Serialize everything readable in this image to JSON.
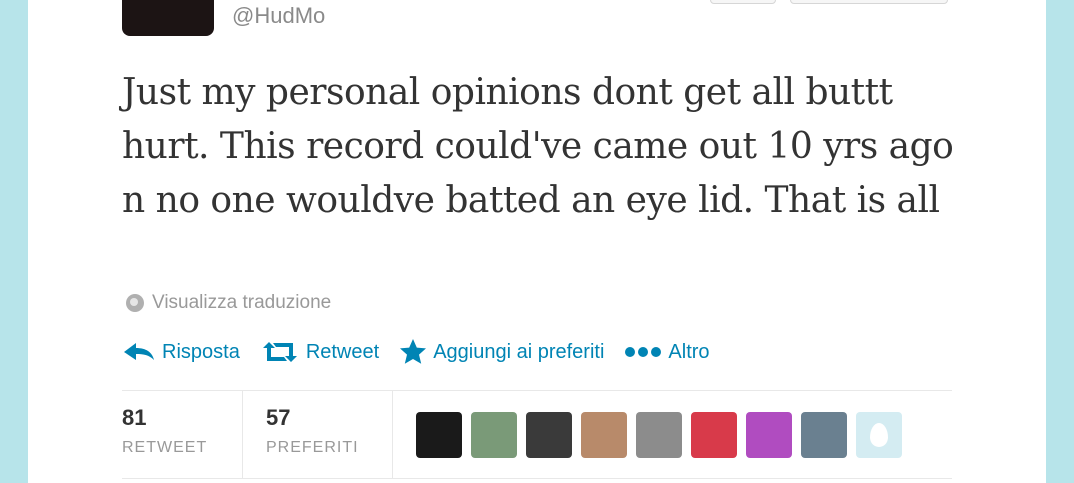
{
  "tweet": {
    "handle": "@HudMo",
    "text": "Just my personal opinions dont get all buttt hurt. This record could've came out 10 yrs ago n no one wouldve batted an eye lid. That is all",
    "translate_link": "Visualizza traduzione"
  },
  "actions": [
    {
      "label": "Risposta",
      "icon": "reply-icon"
    },
    {
      "label": "Retweet",
      "icon": "retweet-icon"
    },
    {
      "label": "Aggiungi ai preferiti",
      "icon": "star-icon"
    },
    {
      "label": "Altro",
      "icon": "more-icon"
    }
  ],
  "stats": {
    "retweets_count": "81",
    "retweets_label": "RETWEET",
    "favorites_count": "57",
    "favorites_label": "PREFERITI"
  },
  "avatars": {
    "colors": [
      "#1a1a1a",
      "#7a9a78",
      "#3a3a3a",
      "#b88a6a",
      "#8c8c8c",
      "#d83a4a",
      "#b04cc0",
      "#6a8090",
      "#d4ecf2"
    ]
  },
  "colors": {
    "link": "#0084b4",
    "background": "#b7e4ea"
  }
}
